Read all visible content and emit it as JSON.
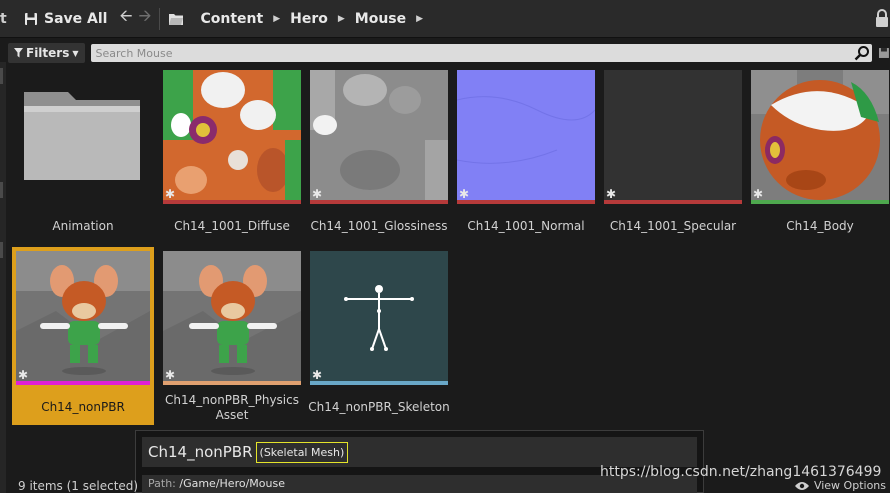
{
  "toolbar": {
    "save_all_label": "Save All",
    "breadcrumbs": [
      "Content",
      "Hero",
      "Mouse"
    ]
  },
  "filter_bar": {
    "filters_label": "Filters",
    "search_placeholder": "Search Mouse"
  },
  "assets": [
    {
      "name": "Animation",
      "type": "folder"
    },
    {
      "name": "Ch14_1001_Diffuse",
      "type": "texture",
      "bar_color": "#b63a3a"
    },
    {
      "name": "Ch14_1001_Glossiness",
      "type": "texture",
      "bar_color": "#b63a3a"
    },
    {
      "name": "Ch14_1001_Normal",
      "type": "texture",
      "bar_color": "#b63a3a"
    },
    {
      "name": "Ch14_1001_Specular",
      "type": "texture",
      "bar_color": "#b63a3a"
    },
    {
      "name": "Ch14_Body",
      "type": "material",
      "bar_color": "#4ea84e"
    },
    {
      "name": "Ch14_nonPBR",
      "type": "skeletal-mesh",
      "bar_color": "#e01fd6",
      "selected": true
    },
    {
      "name": "Ch14_nonPBR_Physics Asset",
      "type": "physics-asset",
      "bar_color": "#e0a070"
    },
    {
      "name": "Ch14_nonPBR_Skeleton",
      "type": "skeleton",
      "bar_color": "#6aa8c8"
    }
  ],
  "tooltip": {
    "name": "Ch14_nonPBR",
    "type": "(Skeletal Mesh)",
    "path_label": "Path:",
    "path_value": "/Game/Hero/Mouse"
  },
  "status": {
    "count_text": "9 items (1 selected)",
    "view_options_label": "View Options"
  },
  "watermark": "https://blog.csdn.net/zhang1461376499",
  "colors": {
    "selection": "#dd9f1c",
    "texture_bar": "#b63a3a",
    "material_bar": "#4ea84e",
    "mesh_bar": "#e01fd6",
    "physics_bar": "#e0a070",
    "skeleton_bar": "#6aa8c8"
  }
}
